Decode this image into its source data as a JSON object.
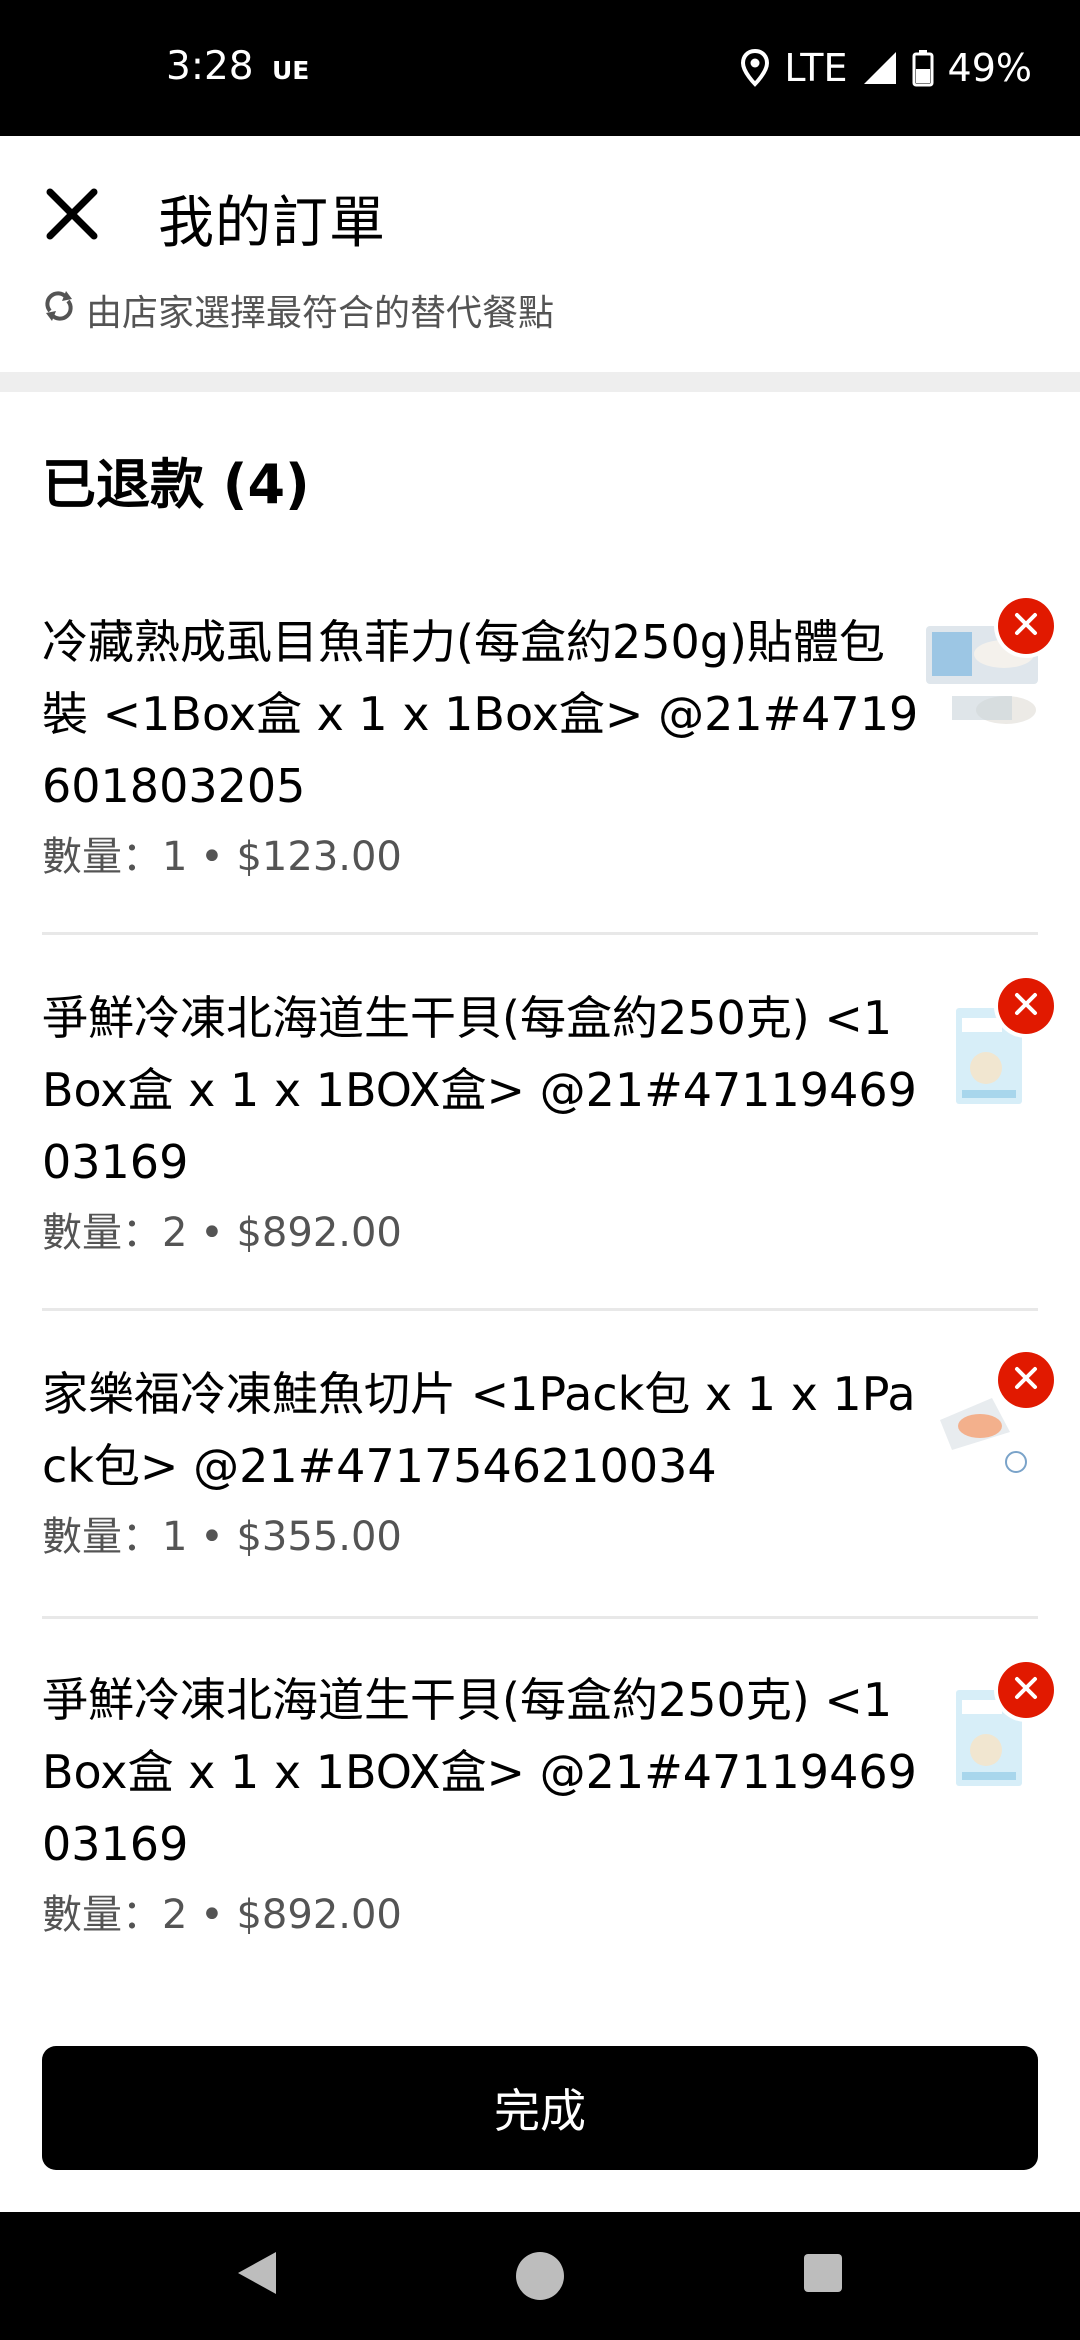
{
  "status_bar": {
    "time": "3:28",
    "carrier": "UE",
    "network": "LTE",
    "battery": "49%"
  },
  "header": {
    "title": "我的訂單",
    "substitute_note": "由店家選擇最符合的替代餐點",
    "close_icon": "close-icon"
  },
  "section": {
    "title": "已退款 (4)"
  },
  "items": [
    {
      "name": "冷藏熟成虱目魚菲力(每盒約250g)貼體包裝 <1Box盒 x 1 x 1Box盒> @21#4719601803205",
      "meta": "數量：1 • $123.00"
    },
    {
      "name": "爭鮮冷凍北海道生干貝(每盒約250克) <1Box盒 x 1 x 1BOX盒> @21#4711946903169",
      "meta": "數量：2 • $892.00"
    },
    {
      "name": "家樂福冷凍鮭魚切片 <1Pack包 x 1 x 1Pack包> @21#4717546210034",
      "meta": "數量：1 • $355.00"
    },
    {
      "name": "爭鮮冷凍北海道生干貝(每盒約250克) <1Box盒 x 1 x 1BOX盒> @21#4711946903169",
      "meta": "數量：2 • $892.00"
    }
  ],
  "done_button": {
    "label": "完成"
  },
  "colors": {
    "accent": "#000000",
    "remove_badge": "#e11900",
    "muted_text": "#545454"
  }
}
